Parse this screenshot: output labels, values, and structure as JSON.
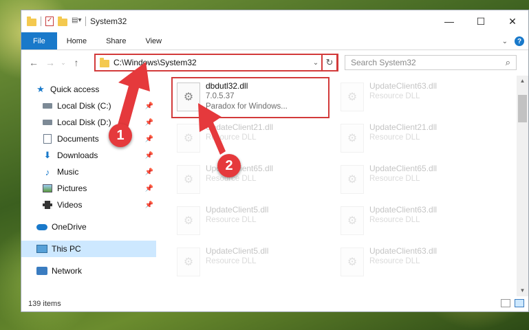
{
  "window": {
    "title": "System32",
    "controls": {
      "minimize": "—",
      "maximize": "☐",
      "close": "✕"
    }
  },
  "ribbon": {
    "tabs": [
      "File",
      "Home",
      "Share",
      "View"
    ],
    "help": "?"
  },
  "address": {
    "path": "C:\\Windows\\System32",
    "search_placeholder": "Search System32"
  },
  "nav": {
    "quick_access": "Quick access",
    "items": [
      {
        "label": "Local Disk (C:)",
        "icon": "drive-icon"
      },
      {
        "label": "Local Disk (D:)",
        "icon": "drive-icon"
      },
      {
        "label": "Documents",
        "icon": "documents-icon"
      },
      {
        "label": "Downloads",
        "icon": "downloads-icon"
      },
      {
        "label": "Music",
        "icon": "music-icon"
      },
      {
        "label": "Pictures",
        "icon": "pictures-icon"
      },
      {
        "label": "Videos",
        "icon": "videos-icon"
      }
    ],
    "onedrive": "OneDrive",
    "this_pc": "This PC",
    "network": "Network"
  },
  "files": [
    {
      "name": "dbdutl32.dll",
      "line2": "7.0.5.37",
      "line3": "Paradox for Windows...",
      "state": "highlight"
    },
    {
      "name": "UpdateClient63.dll",
      "line2": "Resource DLL",
      "state": "faded"
    },
    {
      "name": "UpdateClient21.dll",
      "line2": "Resource DLL",
      "state": "faded"
    },
    {
      "name": "UpdateClient21.dll",
      "line2": "Resource DLL",
      "state": "faded"
    },
    {
      "name": "UpdateClient65.dll",
      "line2": "Resource DLL",
      "state": "faded"
    },
    {
      "name": "UpdateClient65.dll",
      "line2": "Resource DLL",
      "state": "faded"
    },
    {
      "name": "UpdateClient5.dll",
      "line2": "Resource DLL",
      "state": "faded"
    },
    {
      "name": "UpdateClient63.dll",
      "line2": "Resource DLL",
      "state": "faded"
    },
    {
      "name": "UpdateClient5.dll",
      "line2": "Resource DLL",
      "state": "faded"
    },
    {
      "name": "UpdateClient63.dll",
      "line2": "Resource DLL",
      "state": "faded"
    }
  ],
  "status": {
    "item_count": "139 items"
  },
  "annotations": {
    "marker1": "1",
    "marker2": "2",
    "color": "#e5393c"
  }
}
